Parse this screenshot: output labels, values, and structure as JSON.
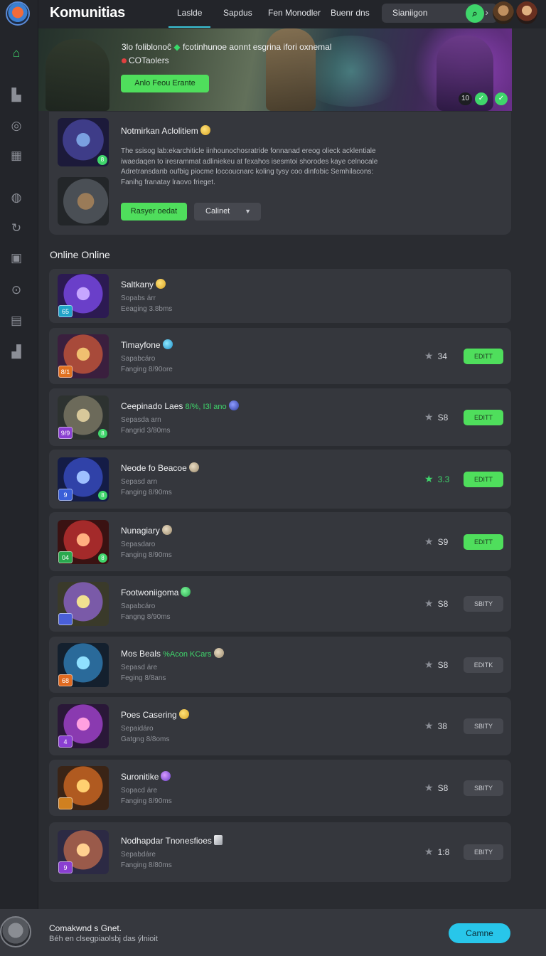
{
  "brand": "Komunitias",
  "nav": [
    "Laslde",
    "Sapdus",
    "Fen Monodler",
    "Buenr dns"
  ],
  "search": {
    "value": "Sianiigon"
  },
  "hero": {
    "title": "3lo foliblonoĉ",
    "title_tail": "fcotinhunoe aonnt esgrina ifori oxnemal",
    "subtitle": "COTaolers",
    "button": "Anlo Feou Erante",
    "badges": [
      "10",
      "✓",
      "✓"
    ]
  },
  "feature": {
    "title": "Notmirkan Aclolitiem",
    "description": "The ssisog lab:ekarchiticle iinhounochosratride fonnanad ereog olieck acklentiale iwaedaqen to iresrammat adliniekeu at fexahos isesmtoi shorodes kaye celnocale Adretransdanb oufbig piocme loccoucnarc koling tysy coo dinfobic Semhilacons: Fanihg franatay lraovo frieget.",
    "button_primary": "Rasyer oedat",
    "button_secondary": "Calinet",
    "badge": "8"
  },
  "section_title": "Online Online",
  "rows": [
    {
      "name": "Saltkany",
      "extra": "",
      "meta1": "Sopabs árr",
      "meta2": "Eeaging 3.8bms",
      "level": "65",
      "level_color": "#20a3c8",
      "rating": "",
      "action": "",
      "action_style": ""
    },
    {
      "name": "Timayfone",
      "extra": "",
      "meta1": "Sapabcáro",
      "meta2": "Fanging 8/90ore",
      "level": "8/1",
      "level_color": "#e07020",
      "rating": "34",
      "action": "EDITT",
      "action_style": "green"
    },
    {
      "name": "Ceepinado Laes",
      "extra": "8/%, I3l ano",
      "meta1": "Sepasda arn",
      "meta2": "Fangrid 3/80ms",
      "level": "9/9",
      "level_color": "#8a3fd1",
      "rating": "S8",
      "action": "EDITT",
      "action_style": "green"
    },
    {
      "name": "Neode fo Beacoe",
      "extra": "",
      "meta1": "Sepasd arn",
      "meta2": "Fanging 8/90ms",
      "level": "9",
      "level_color": "#3a5fd8",
      "rating": "3.3",
      "action": "EDITT",
      "action_style": "green"
    },
    {
      "name": "Nunagiary",
      "extra": "",
      "meta1": "Sepasdaro",
      "meta2": "Fanging 8/90ms",
      "level": "04",
      "level_color": "#2aa84e",
      "rating": "S9",
      "action": "EDITT",
      "action_style": "green"
    },
    {
      "name": "Footwoniigoma",
      "extra": "",
      "meta1": "Sapabcáro",
      "meta2": "Fangng 8/90ms",
      "level": "",
      "level_color": "#4a5fd8",
      "rating": "S8",
      "action": "SBITY",
      "action_style": "gray"
    },
    {
      "name": "Mos Beals",
      "extra": "%Acon KCars",
      "meta1": "Sepasd áre",
      "meta2": "Feging 8/8ans",
      "level": "68",
      "level_color": "#e06a20",
      "rating": "S8",
      "action": "EDITK",
      "action_style": "gray"
    },
    {
      "name": "Poes Casering",
      "extra": "",
      "meta1": "Sepaidáro",
      "meta2": "Gatgng 8/8oms",
      "level": "4",
      "level_color": "#8a3fd1",
      "rating": "38",
      "action": "SBITY",
      "action_style": "gray"
    },
    {
      "name": "Suronitike",
      "extra": "",
      "meta1": "Sopacd áre",
      "meta2": "Fanging 8/90ms",
      "level": "",
      "level_color": "#d08020",
      "rating": "S8",
      "action": "SBITY",
      "action_style": "gray"
    },
    {
      "name": "Nodhapdar Tnonesfioes",
      "extra": "",
      "meta1": "Sepabdáre",
      "meta2": "Fanging 8/80ms",
      "level": "9",
      "level_color": "#8a3fd1",
      "rating": "1:8",
      "action": "EBITY",
      "action_style": "gray"
    }
  ],
  "footer": {
    "title": "Comakwnd s Gnet.",
    "subtitle": "Béh en clsegpiaolsbj das ýlnioit",
    "button": "Camne"
  },
  "colors": {
    "accent_green": "#4fde5c",
    "accent_cyan": "#28c6ea",
    "background": "#2a2c31",
    "card": "#35373d"
  },
  "icons": [
    "app-logo",
    "home-icon",
    "store-icon",
    "compass-icon",
    "grid-icon",
    "globe-icon",
    "refresh-icon",
    "lock-icon",
    "search-icon",
    "layout-icon",
    "chart-icon"
  ]
}
